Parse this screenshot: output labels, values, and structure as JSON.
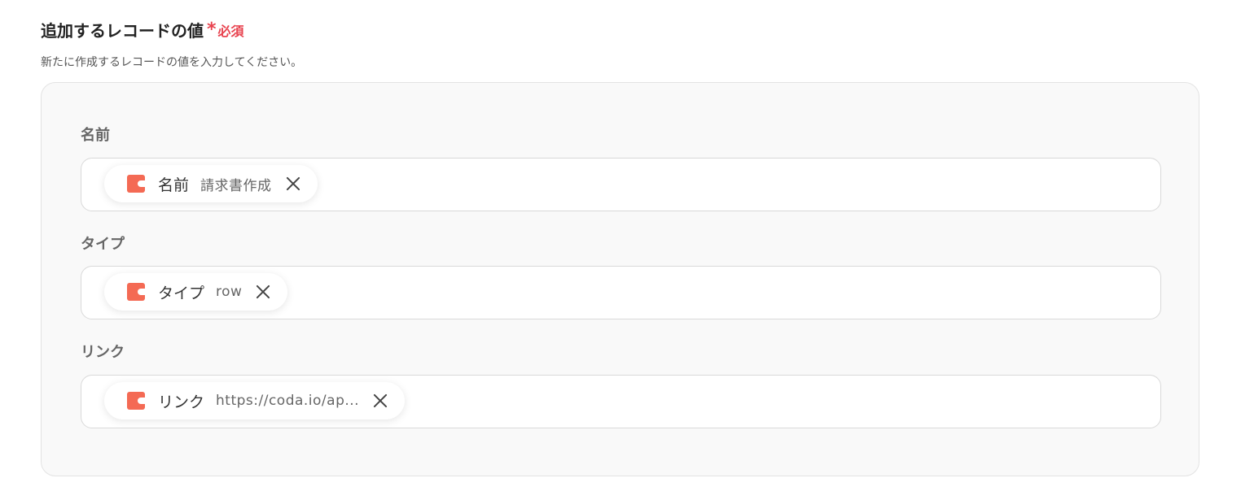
{
  "section": {
    "title": "追加するレコードの値",
    "required_star": "*",
    "required_text": "必須",
    "description": "新たに作成するレコードの値を入力してください。"
  },
  "fields": [
    {
      "label": "名前",
      "chip": {
        "icon": "coda-icon",
        "name": "名前",
        "value": "請求書作成"
      }
    },
    {
      "label": "タイプ",
      "chip": {
        "icon": "coda-icon",
        "name": "タイプ",
        "value": "row"
      }
    },
    {
      "label": "リンク",
      "chip": {
        "icon": "coda-icon",
        "name": "リンク",
        "value": "https://coda.io/ap..."
      }
    }
  ],
  "colors": {
    "required": "#e8434f",
    "coda_brand": "#f46a54",
    "panel_background": "#f9f9f9"
  }
}
